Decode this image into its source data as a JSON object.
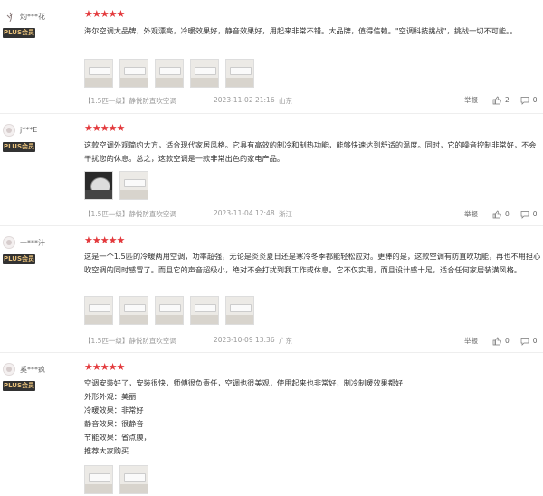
{
  "reviews": [
    {
      "username": "灼***花",
      "badge": "PLUS会员",
      "stars": "★★★★★",
      "content": "海尔空调大品牌，外观漂亮，冷暖效果好，静音效果好，用起来非常不错。大品牌，值得信赖。\"空调科技挑战\"，挑战一切不可能。。",
      "spec": "【1.5匹一级】静悦防直吹空调",
      "date": "2023-11-02 21:16",
      "location": "山东",
      "report": "举报",
      "likes": "2",
      "comments": "0"
    },
    {
      "username": "j***E",
      "badge": "PLUS会员",
      "stars": "★★★★★",
      "content": "这款空调外观简约大方，适合现代家居风格。它具有高效的制冷和制热功能，能够快速达到舒适的温度。同时，它的噪音控制非常好，不会干扰您的休息。总之，这款空调是一款非常出色的家电产品。",
      "spec": "【1.5匹一级】静悦防直吹空调",
      "date": "2023-11-04 12:48",
      "location": "浙江",
      "report": "举报",
      "likes": "0",
      "comments": "0"
    },
    {
      "username": "一***汁",
      "badge": "PLUS会员",
      "stars": "★★★★★",
      "content": "这是一个1.5匹的冷暖两用空调，功率超强，无论是炎炎夏日还是寒冷冬季都能轻松应对。更棒的是，这款空调有防直吹功能，再也不用担心吹空调的同时感冒了。而且它的声音超级小，绝对不会打扰到我工作或休息。它不仅实用，而且设计感十足，适合任何家居装潢风格。",
      "spec": "【1.5匹一级】静悦防直吹空调",
      "date": "2023-10-09 13:36",
      "location": "广东",
      "report": "举报",
      "likes": "0",
      "comments": "0"
    },
    {
      "username": "奚***疯",
      "badge": "PLUS会员",
      "stars": "★★★★★",
      "content": "空调安装好了，安装很快，师傅很负责任，空调也很美观，使用起来也非常好，制冷制暖效果都好",
      "lines": [
        "外形外观：美丽",
        "冷暖效果：非常好",
        "静音效果：很静音",
        "节能效果：省点膜，",
        "推荐大家购买"
      ]
    }
  ],
  "icons": {
    "like": "thumbs-up-icon",
    "comment": "comment-icon"
  },
  "colors": {
    "star": "#e3393c",
    "badge_bg": "#323232",
    "badge_text": "#e7c07a"
  }
}
